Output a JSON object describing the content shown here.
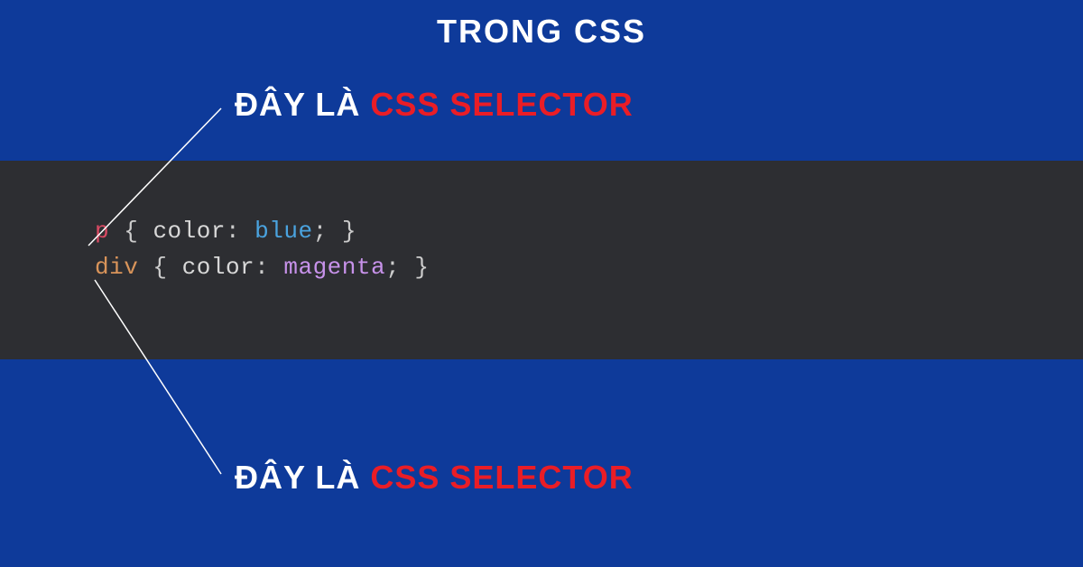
{
  "title": "TRONG CSS",
  "labels": {
    "top": {
      "prefix": "ĐÂY LÀ ",
      "highlight": "CSS SELECTOR"
    },
    "bottom": {
      "prefix": "ĐÂY LÀ ",
      "highlight": "CSS SELECTOR"
    }
  },
  "code": {
    "line1": {
      "selector": "p",
      "open": "{",
      "property": "color",
      "colon": ":",
      "value": "blue",
      "semi": ";",
      "close": "}"
    },
    "line2": {
      "selector": "div",
      "open": "{",
      "property": "color",
      "colon": ":",
      "value": "magenta",
      "semi": ";",
      "close": "}"
    }
  },
  "colors": {
    "background": "#0e3a9a",
    "codeBackground": "#2d2e32",
    "highlight": "#ea1d26",
    "text": "#ffffff"
  }
}
